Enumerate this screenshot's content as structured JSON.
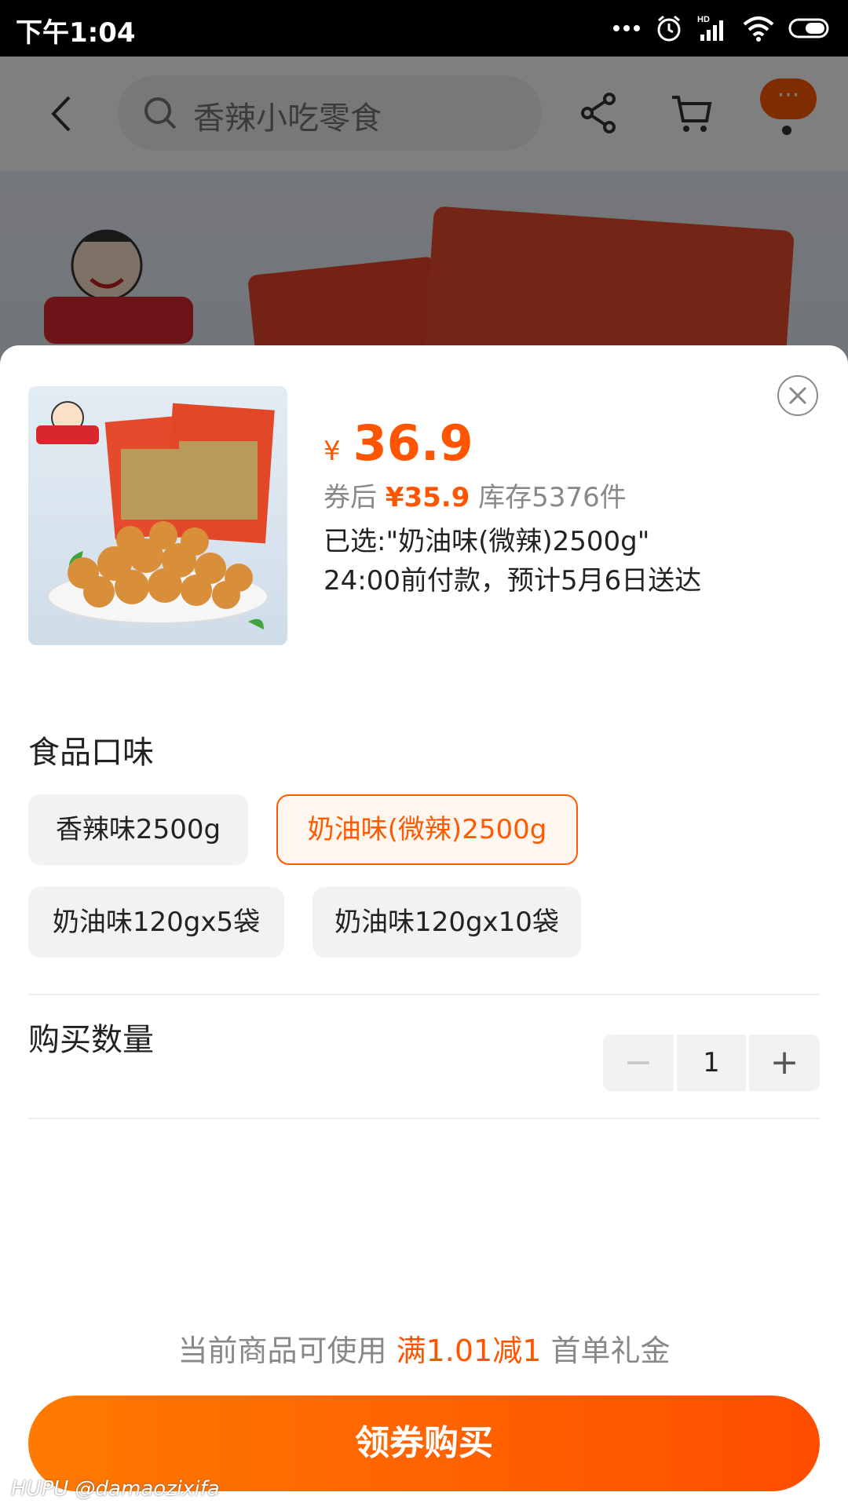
{
  "status_bar": {
    "time": "下午1:04",
    "hd": "HD"
  },
  "topbar": {
    "search_placeholder": "香辣小吃零食",
    "more_label": "···"
  },
  "sheet": {
    "currency": "¥",
    "price": "36.9",
    "coupon_prefix": "券后",
    "coupon_price": "¥35.9",
    "stock": "库存5376件",
    "selected": "已选:\"奶油味(微辣)2500g\"",
    "delivery": "24:00前付款，预计5月6日送达",
    "flavor_title": "食品口味",
    "options": [
      {
        "label": "香辣味2500g",
        "selected": false
      },
      {
        "label": "奶油味(微辣)2500g",
        "selected": true
      },
      {
        "label": "奶油味120gx5袋",
        "selected": false
      },
      {
        "label": "奶油味120gx10袋",
        "selected": false
      }
    ],
    "quantity_label": "购买数量",
    "quantity": "1",
    "promo_prefix": "当前商品可使用",
    "promo_highlight": "满1.01减1",
    "promo_suffix": "首单礼金",
    "buy_label": "领券购买"
  },
  "watermark": "HUPU @damaozixifa",
  "colors": {
    "accent": "#ff5500",
    "button_start": "#ff7a00",
    "button_end": "#ff4d00"
  }
}
